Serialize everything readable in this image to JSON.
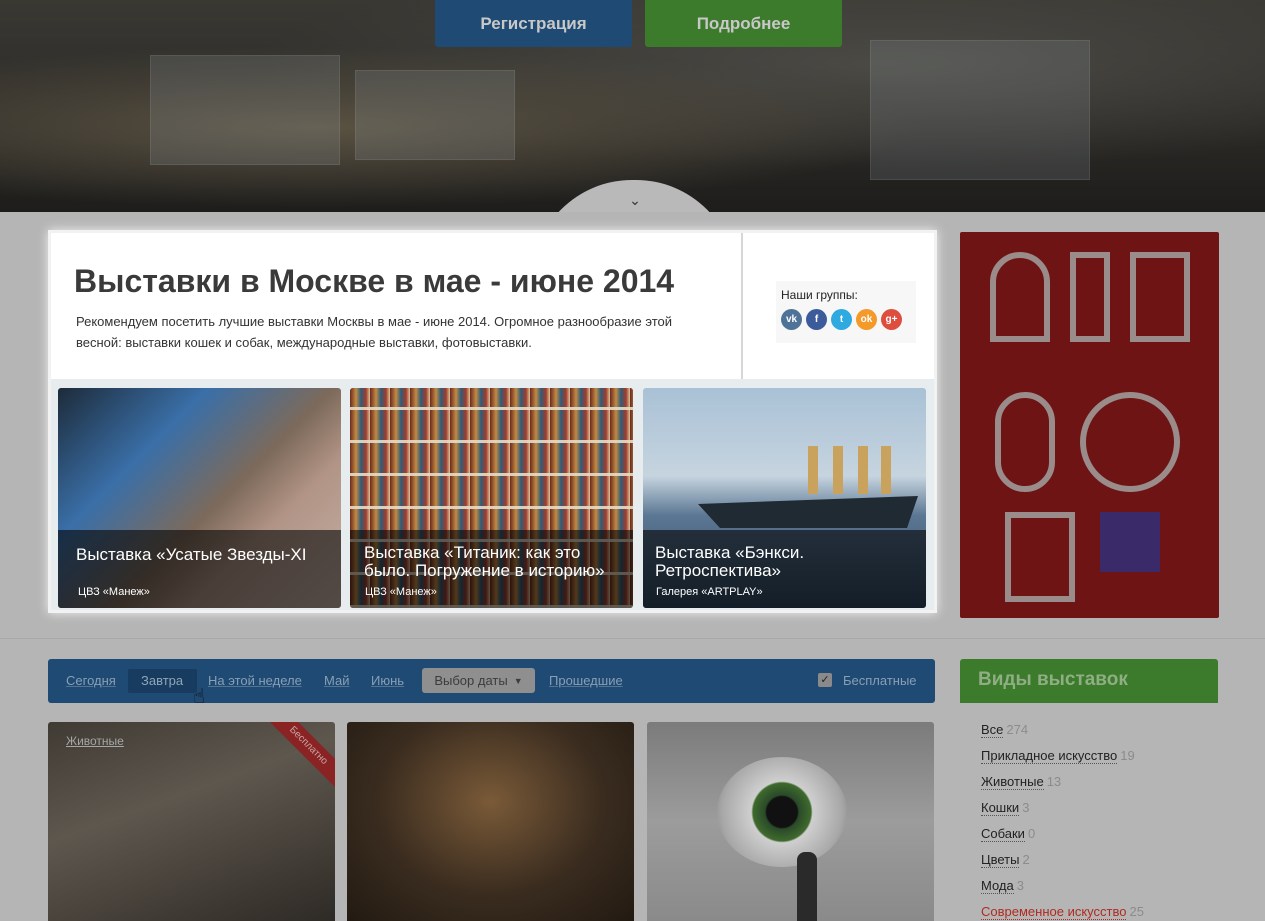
{
  "hero": {
    "register_label": "Регистрация",
    "more_label": "Подробнее",
    "scroll_icon": "chevron-down-icon"
  },
  "feature": {
    "title": "Выставки в Москве в мае - июне 2014",
    "description": "Рекомендуем посетить лучшие выставки Москвы в мае - июне 2014. Огромное разнообразие этой весной: выставки кошек и собак, международные выставки, фотовыставки.",
    "groups_label": "Наши группы:",
    "social": [
      {
        "name": "vk",
        "glyph": "vk",
        "color": "#4f7398"
      },
      {
        "name": "facebook",
        "glyph": "f",
        "color": "#3b5b9b"
      },
      {
        "name": "twitter",
        "glyph": "t",
        "color": "#2eaae1"
      },
      {
        "name": "odnoklassniki",
        "glyph": "ok",
        "color": "#f39a2a"
      },
      {
        "name": "google-plus",
        "glyph": "g+",
        "color": "#dd4e3f"
      }
    ],
    "cards": [
      {
        "title_line1": "Выставка «Усатые Звезды-XI",
        "title_line2": "",
        "venue": "ЦВЗ «Манеж»"
      },
      {
        "title_line1": "Выставка «Титаник: как это",
        "title_line2": "было. Погружение в историю»",
        "venue": "ЦВЗ «Манеж»"
      },
      {
        "title_line1": "Выставка «Бэнкси.",
        "title_line2": "Ретроспектива»",
        "venue": "Галерея «ARTPLAY»"
      }
    ]
  },
  "filters": {
    "items": [
      "Сегодня",
      "Завтра",
      "На этой неделе",
      "Май",
      "Июнь"
    ],
    "date_picker_label": "Выбор даты",
    "past_label": "Прошедшие",
    "free_label": "Бесплатные",
    "free_checked": true
  },
  "categories": {
    "title": "Виды выставок",
    "items": [
      {
        "label": "Все",
        "count": "274"
      },
      {
        "label": "Прикладное искусство",
        "count": "19"
      },
      {
        "label": "Животные",
        "count": "13"
      },
      {
        "label": "Кошки",
        "count": "3"
      },
      {
        "label": "Собаки",
        "count": "0"
      },
      {
        "label": "Цветы",
        "count": "2"
      },
      {
        "label": "Мода",
        "count": "3"
      },
      {
        "label": "Современное искусство",
        "count": "25"
      }
    ]
  },
  "listing": {
    "card1_tag": "Животные",
    "card1_ribbon": "Бесплатно"
  },
  "colors": {
    "accent_blue": "#1e4a74",
    "accent_green": "#3c7a2c",
    "highlight_red": "#b02a20"
  }
}
